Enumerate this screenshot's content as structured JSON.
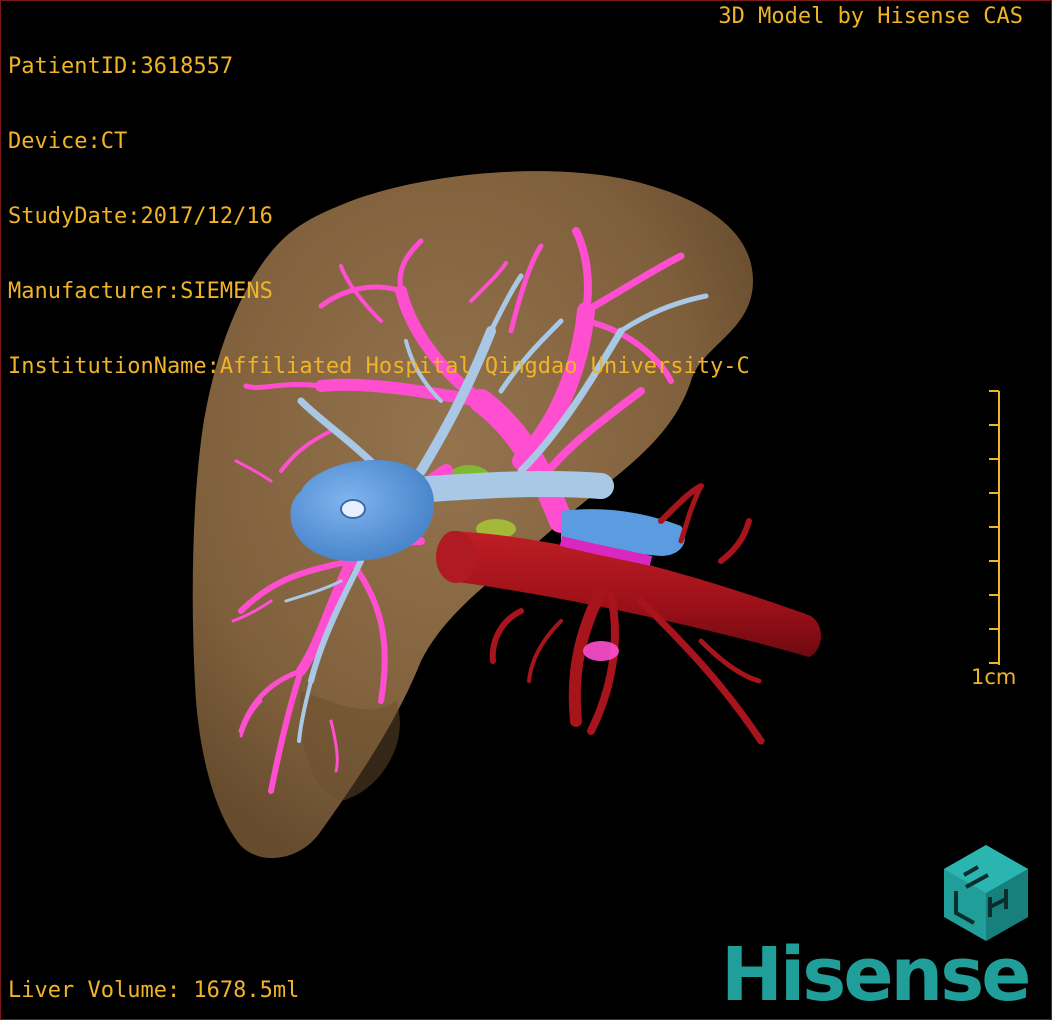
{
  "metadata": {
    "patient_id": "PatientID:3618557",
    "device": "Device:CT",
    "study_date": "StudyDate:2017/12/16",
    "manufacturer": "Manufacturer:SIEMENS",
    "institution": "InstitutionName:Affiliated Hospital Qingdao University-C"
  },
  "credit": "3D Model by Hisense CAS",
  "liver_volume": "Liver Volume: 1678.5ml",
  "scale_bar": {
    "label": "1cm"
  },
  "brand": {
    "name": "Hisense",
    "logo_icon": "hisense-cube-icon"
  },
  "colors": {
    "overlay_text": "#f0b429",
    "liver": "#8a6a44",
    "portal_vein": "#ff4fd0",
    "hepatic_vein": "#a9c8e6",
    "vena_cava_blue": "#5b9be0",
    "artery": "#a8141c",
    "brand": "#1f9e9a"
  }
}
